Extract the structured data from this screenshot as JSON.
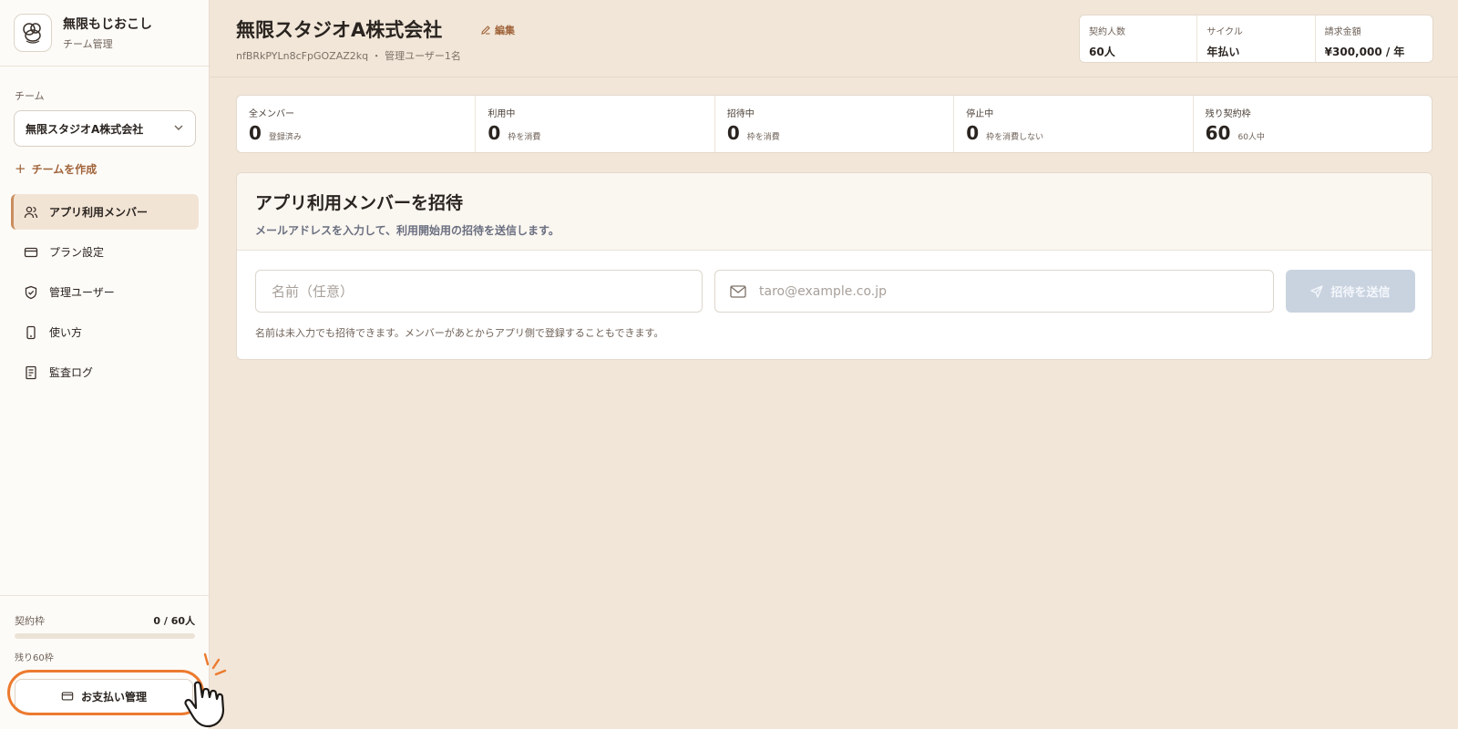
{
  "brand": {
    "name": "無限もじおこし",
    "subtitle": "チーム管理"
  },
  "sidebar": {
    "team_label": "チーム",
    "team_selected": "無限スタジオA株式会社",
    "create_team_label": "チームを作成",
    "items": [
      {
        "label": "アプリ利用メンバー",
        "icon": "users-icon",
        "active": true
      },
      {
        "label": "プラン設定",
        "icon": "credit-card-icon",
        "active": false
      },
      {
        "label": "管理ユーザー",
        "icon": "shield-check-icon",
        "active": false
      },
      {
        "label": "使い方",
        "icon": "phone-icon",
        "active": false
      },
      {
        "label": "監査ログ",
        "icon": "document-icon",
        "active": false
      }
    ],
    "quota": {
      "label": "契約枠",
      "value_text": "0 / 60人",
      "used": 0,
      "total": 60,
      "remaining_text": "残り60枠"
    },
    "payment_button_label": "お支払い管理"
  },
  "header": {
    "title": "無限スタジオA株式会社",
    "edit_label": "編集",
    "meta": "nfBRkPYLn8cFpGOZAZ2kq ・ 管理ユーザー1名",
    "contract": [
      {
        "label": "契約人数",
        "value": "60人"
      },
      {
        "label": "サイクル",
        "value": "年払い"
      },
      {
        "label": "請求金額",
        "value": "¥300,000 / 年"
      }
    ]
  },
  "stats": [
    {
      "label": "全メンバー",
      "value": "0",
      "note": "登録済み"
    },
    {
      "label": "利用中",
      "value": "0",
      "note": "枠を消費"
    },
    {
      "label": "招待中",
      "value": "0",
      "note": "枠を消費"
    },
    {
      "label": "停止中",
      "value": "0",
      "note": "枠を消費しない"
    },
    {
      "label": "残り契約枠",
      "value": "60",
      "note": "60人中"
    }
  ],
  "invite": {
    "title": "アプリ利用メンバーを招待",
    "description": "メールアドレスを入力して、利用開始用の招待を送信します。",
    "name_placeholder": "名前（任意）",
    "email_placeholder": "taro@example.co.jp",
    "send_label": "招待を送信",
    "hint": "名前は未入力でも招待できます。メンバーがあとからアプリ側で登録することもできます。"
  },
  "colors": {
    "background": "#f1e6d8",
    "accent": "#a0643a",
    "highlight": "#ec7a2e",
    "disabled_button": "#c9d3e0"
  }
}
